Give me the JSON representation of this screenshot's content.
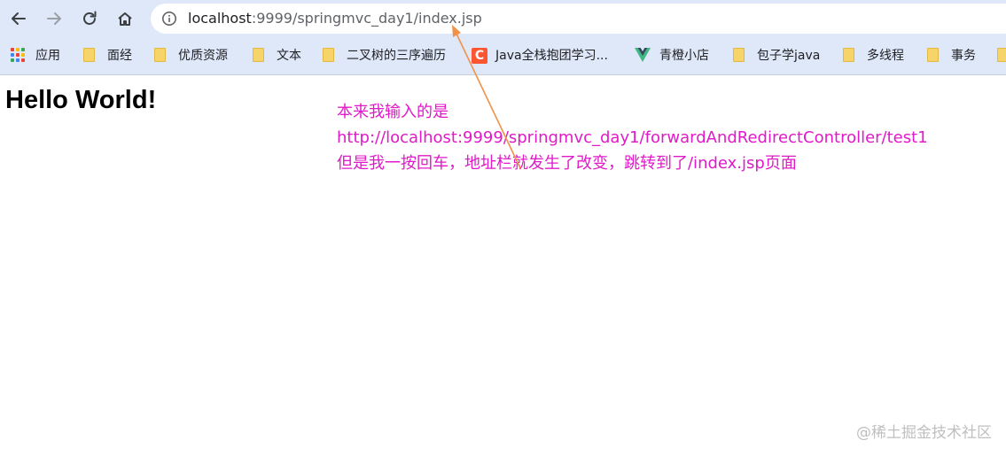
{
  "browser": {
    "url_host": "localhost",
    "url_rest": ":9999/springmvc_day1/index.jsp"
  },
  "bookmarks": [
    {
      "label": "应用",
      "icon": "apps-grid-icon"
    },
    {
      "label": "面经",
      "icon": "folder-icon"
    },
    {
      "label": "优质资源",
      "icon": "folder-icon"
    },
    {
      "label": "文本",
      "icon": "folder-icon"
    },
    {
      "label": "二叉树的三序遍历",
      "icon": "folder-icon"
    },
    {
      "label": "Java全栈抱团学习...",
      "icon": "csdn-c-icon"
    },
    {
      "label": "青橙小店",
      "icon": "vue-icon"
    },
    {
      "label": "包子学java",
      "icon": "folder-icon"
    },
    {
      "label": "多线程",
      "icon": "folder-icon"
    },
    {
      "label": "事务",
      "icon": "folder-icon"
    }
  ],
  "page": {
    "heading": "Hello World!"
  },
  "annotation": {
    "line1": "本来我输入的是",
    "line2": "http://localhost:9999/springmvc_day1/forwardAndRedirectController/test1",
    "line3": "但是我一按回车，地址栏就发生了改变，跳转到了/index.jsp页面",
    "color": "#e01ac8",
    "arrow_color": "#f0924a"
  },
  "watermark": "@稀土掘金技术社区"
}
